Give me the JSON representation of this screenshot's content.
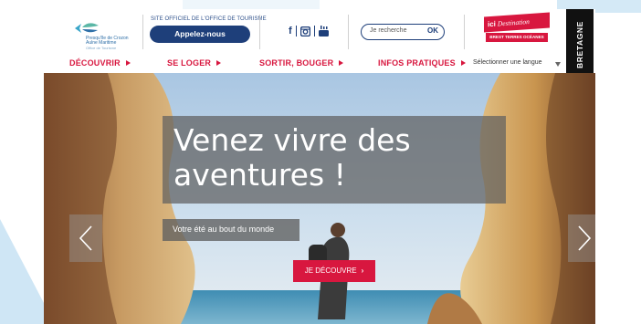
{
  "colors": {
    "brand_red": "#d8173f",
    "navy": "#1e3f7a",
    "overlay": "#5f5f5f"
  },
  "header": {
    "logo": {
      "line1": "Presqu'île de Crozon",
      "line2": "Aulne Maritime",
      "line3": "Office de Tourisme",
      "icon": "fish-logo-icon"
    },
    "official_label": "SITE OFFICIEL DE L'OFFICE DE TOURISME",
    "call_button": "Appelez-nous",
    "social": [
      "facebook-icon",
      "instagram-icon",
      "youtube-icon"
    ],
    "search": {
      "placeholder": "Je recherche",
      "submit": "OK"
    },
    "destination": {
      "ici": "ici",
      "destination": "Destination",
      "region": "BREST TERRES OCÉANES"
    },
    "bretagne": "BRETAGNE"
  },
  "nav": {
    "items": [
      {
        "label": "DÉCOUVRIR"
      },
      {
        "label": "SE LOGER"
      },
      {
        "label": "SORTIR, BOUGER"
      },
      {
        "label": "INFOS PRATIQUES"
      }
    ],
    "language": "Sélectionner une langue"
  },
  "hero": {
    "headline": "Venez vivre des aventures !",
    "subtitle": "Votre été au bout du monde",
    "cta": "JE DÉCOUVRE",
    "cta_icon": "chevron-right-icon",
    "prev_icon": "chevron-left-icon",
    "next_icon": "chevron-right-icon"
  }
}
